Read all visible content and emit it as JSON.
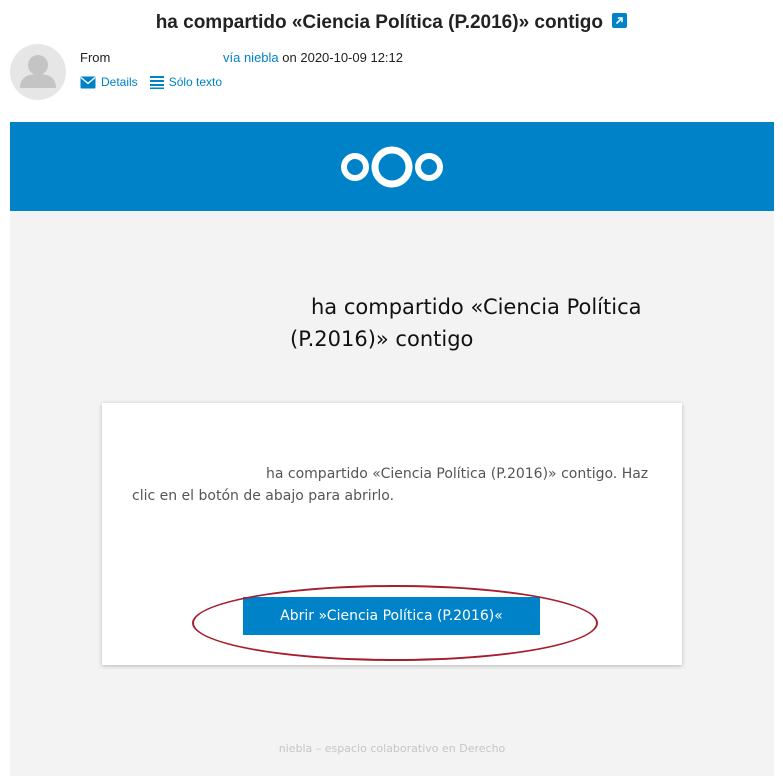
{
  "message": {
    "subject": "ha compartido «Ciencia Política (P.2016)» contigo",
    "from_label": "From",
    "via_text": "vía niebla",
    "date_text": "on 2020-10-09 12:12",
    "actions": {
      "details": "Details",
      "plain_text": "Sólo texto"
    }
  },
  "email": {
    "heading": "ha compartido «Ciencia Política (P.2016)» contigo",
    "body_text": "ha compartido «Ciencia Política (P.2016)» contigo. Haz clic en el botón de abajo para abrirlo.",
    "button_label": "Abrir »Ciencia Política (P.2016)«",
    "footer": "niebla – espacio colaborativo en Derecho"
  },
  "colors": {
    "brand": "#0082c9",
    "annotation": "#a61e2c"
  },
  "icons": {
    "external_link": "external-link-icon",
    "avatar": "avatar-placeholder-icon",
    "details": "envelope-icon",
    "plain_text": "text-lines-icon",
    "logo": "nextcloud-logo-icon"
  }
}
